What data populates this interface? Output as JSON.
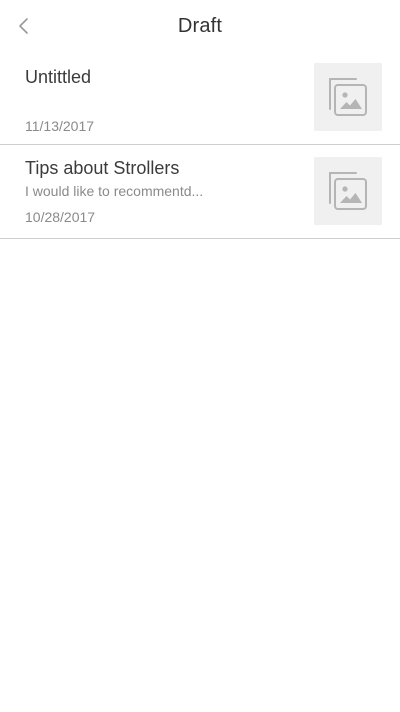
{
  "header": {
    "title": "Draft",
    "back_icon": "chevron-left-icon"
  },
  "drafts": [
    {
      "title": "Untittled",
      "excerpt": "",
      "date": "11/13/2017",
      "thumbnail_icon": "image-placeholder-icon"
    },
    {
      "title": "Tips about Strollers",
      "excerpt": "I would like to recommentd...",
      "date": "10/28/2017",
      "thumbnail_icon": "image-placeholder-icon"
    }
  ],
  "colors": {
    "title_text": "#333333",
    "secondary_text": "#8a8a8a",
    "divider": "#cfcfcf",
    "thumbnail_bg": "#f0f0f0",
    "icon_gray": "#b5b5b5"
  }
}
